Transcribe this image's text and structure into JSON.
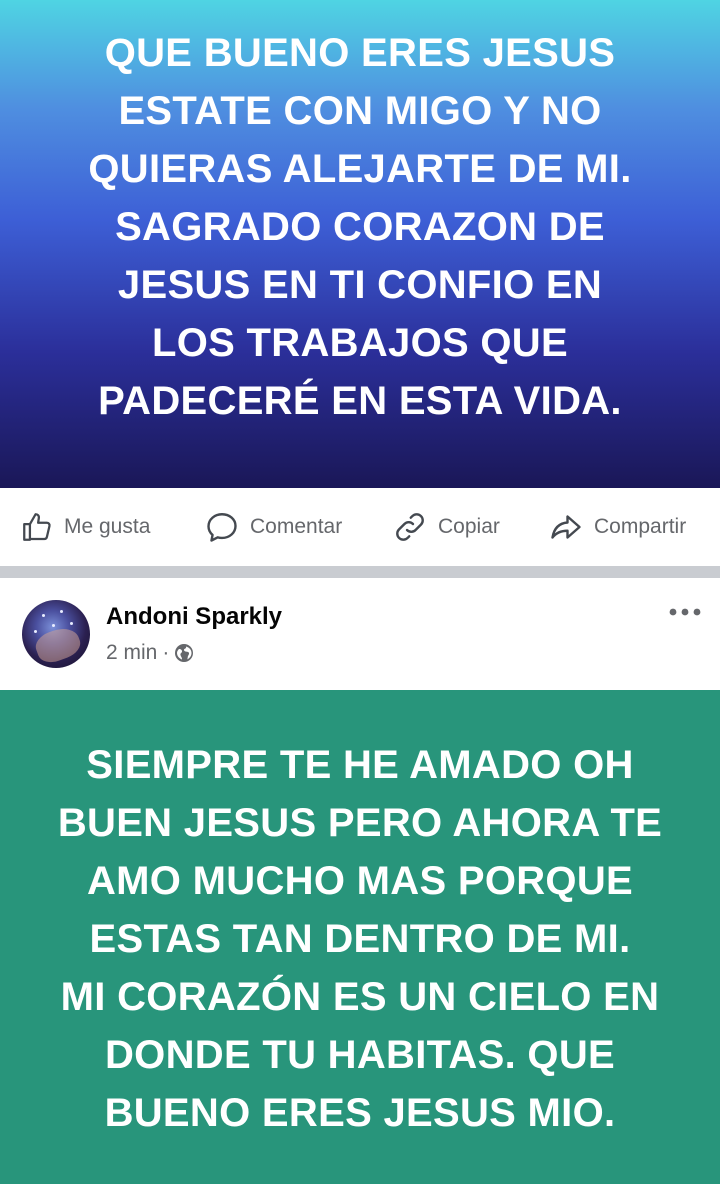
{
  "post1": {
    "text": "QUE BUENO ERES JESUS\nESTATE CON MIGO Y NO\nQUIERAS ALEJARTE DE MI.\nSAGRADO CORAZON DE\nJESUS EN TI CONFIO EN\nLOS TRABAJOS QUE\nPADECERÉ EN ESTA VIDA.",
    "background_colors": [
      "#4fd4e3",
      "#3d5fd6",
      "#1a1757"
    ]
  },
  "actions": {
    "like": {
      "label": "Me gusta",
      "icon": "thumbs-up-icon"
    },
    "comment": {
      "label": "Comentar",
      "icon": "comment-bubble-icon"
    },
    "copy": {
      "label": "Copiar",
      "icon": "link-icon"
    },
    "share": {
      "label": "Compartir",
      "icon": "share-arrow-icon"
    }
  },
  "post2": {
    "author": "Andoni Sparkly",
    "time": "2 min",
    "visibility_icon": "globe-icon",
    "more_icon": "more-options-icon",
    "text": "SIEMPRE TE HE AMADO OH\nBUEN JESUS PERO AHORA TE\nAMO MUCHO MAS PORQUE\nESTAS TAN DENTRO DE MI.\nMI CORAZÓN ES UN CIELO EN\nDONDE TU HABITAS. QUE\nBUENO ERES JESUS MIO.",
    "background_color": "#28957b"
  },
  "colors": {
    "action_text": "#65676b",
    "separator": "#c9ccd1",
    "author_text": "#050505"
  }
}
